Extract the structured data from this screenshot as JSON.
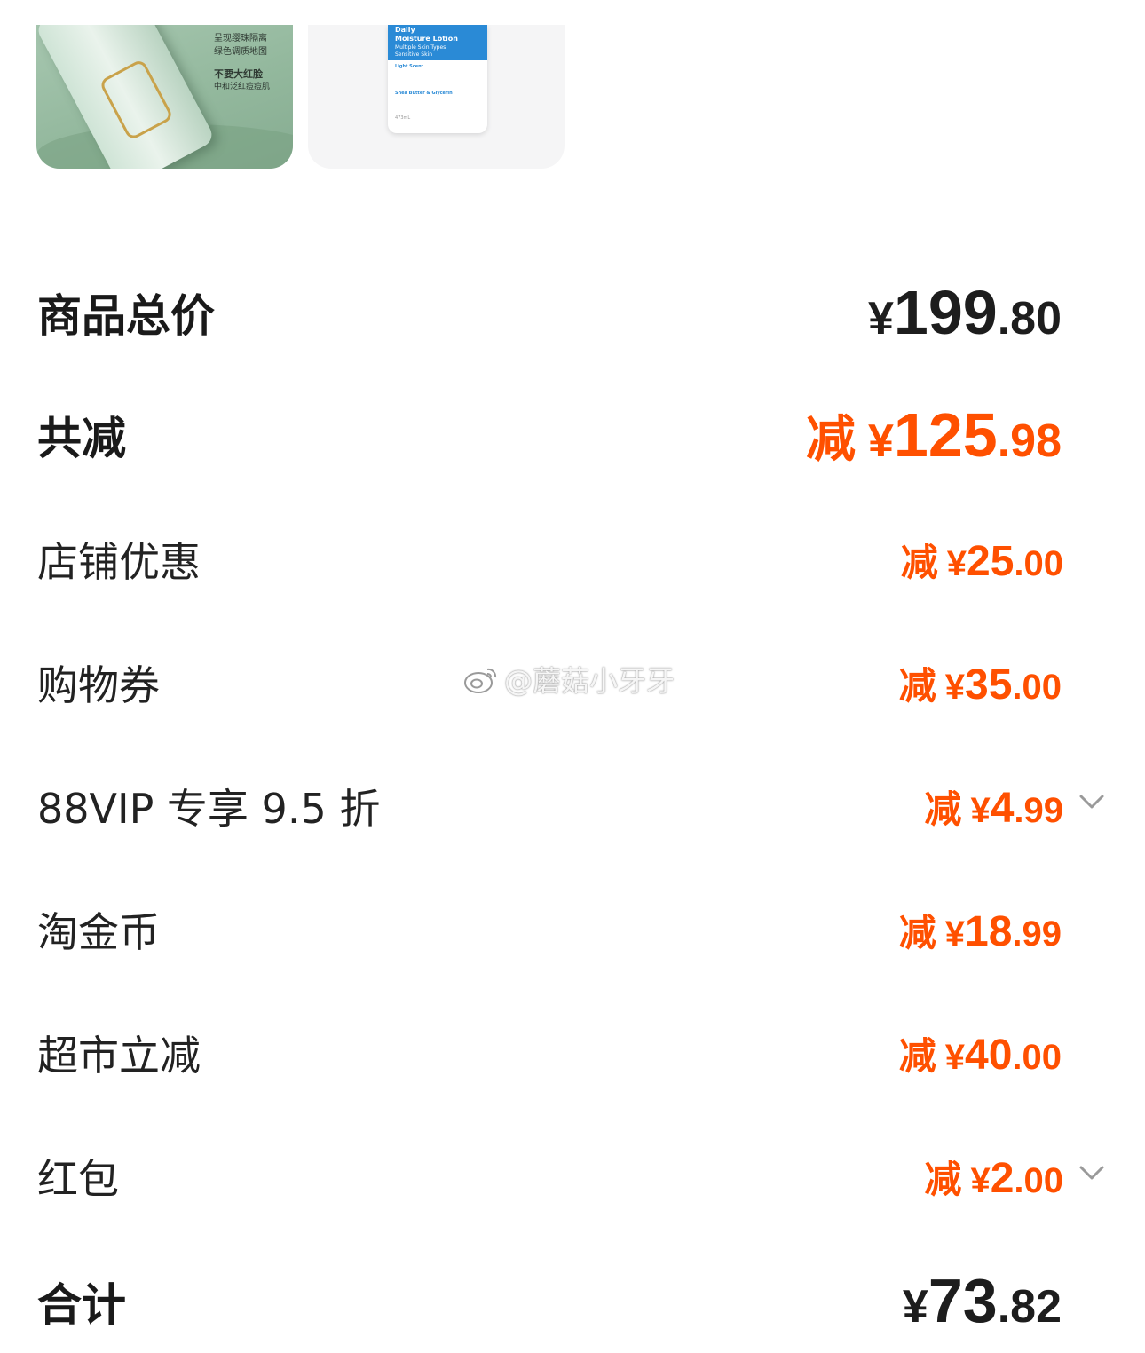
{
  "products": [
    {
      "name": "green-primer-bottle",
      "caption_lines": [
        "呈现缨珠隔离",
        "绿色调质地图",
        "不要大红脸",
        "中和泛红痘痘肌"
      ]
    },
    {
      "name": "daily-moisture-lotion",
      "caption_lines": [
        "Daily",
        "Moisture Lotion",
        "Multiple Skin Types",
        "Sensitive Skin",
        "Light Scent",
        "Shea Butter & Glycerin",
        "473mL"
      ]
    }
  ],
  "summary": {
    "total": {
      "label": "商品总价",
      "yen": "¥",
      "int": "199",
      "dec": ".80"
    },
    "reduction": {
      "label": "共减",
      "prefix": "减",
      "yen": "¥",
      "int": "125",
      "dec": ".98"
    },
    "items": [
      {
        "label": "店铺优惠",
        "prefix": "减",
        "yen": "¥",
        "int": "25",
        "dec": ".00",
        "expandable": false
      },
      {
        "label": "购物券",
        "prefix": "减",
        "yen": "¥",
        "int": "35",
        "dec": ".00",
        "expandable": false
      },
      {
        "label": "88VIP 专享 9.5 折",
        "prefix": "减",
        "yen": "¥",
        "int": "4",
        "dec": ".99",
        "expandable": true
      },
      {
        "label": "淘金币",
        "prefix": "减",
        "yen": "¥",
        "int": "18",
        "dec": ".99",
        "expandable": false
      },
      {
        "label": "超市立减",
        "prefix": "减",
        "yen": "¥",
        "int": "40",
        "dec": ".00",
        "expandable": false
      },
      {
        "label": "红包",
        "prefix": "减",
        "yen": "¥",
        "int": "2",
        "dec": ".00",
        "expandable": true
      }
    ],
    "grand_total": {
      "label": "合计",
      "yen": "¥",
      "int": "73",
      "dec": ".82"
    }
  },
  "watermark": {
    "text": "@蘑菇小牙牙",
    "icon": "weibo-icon"
  },
  "colors": {
    "accent": "#ff5000",
    "text": "#222222",
    "chevron": "#9a9a9a"
  }
}
